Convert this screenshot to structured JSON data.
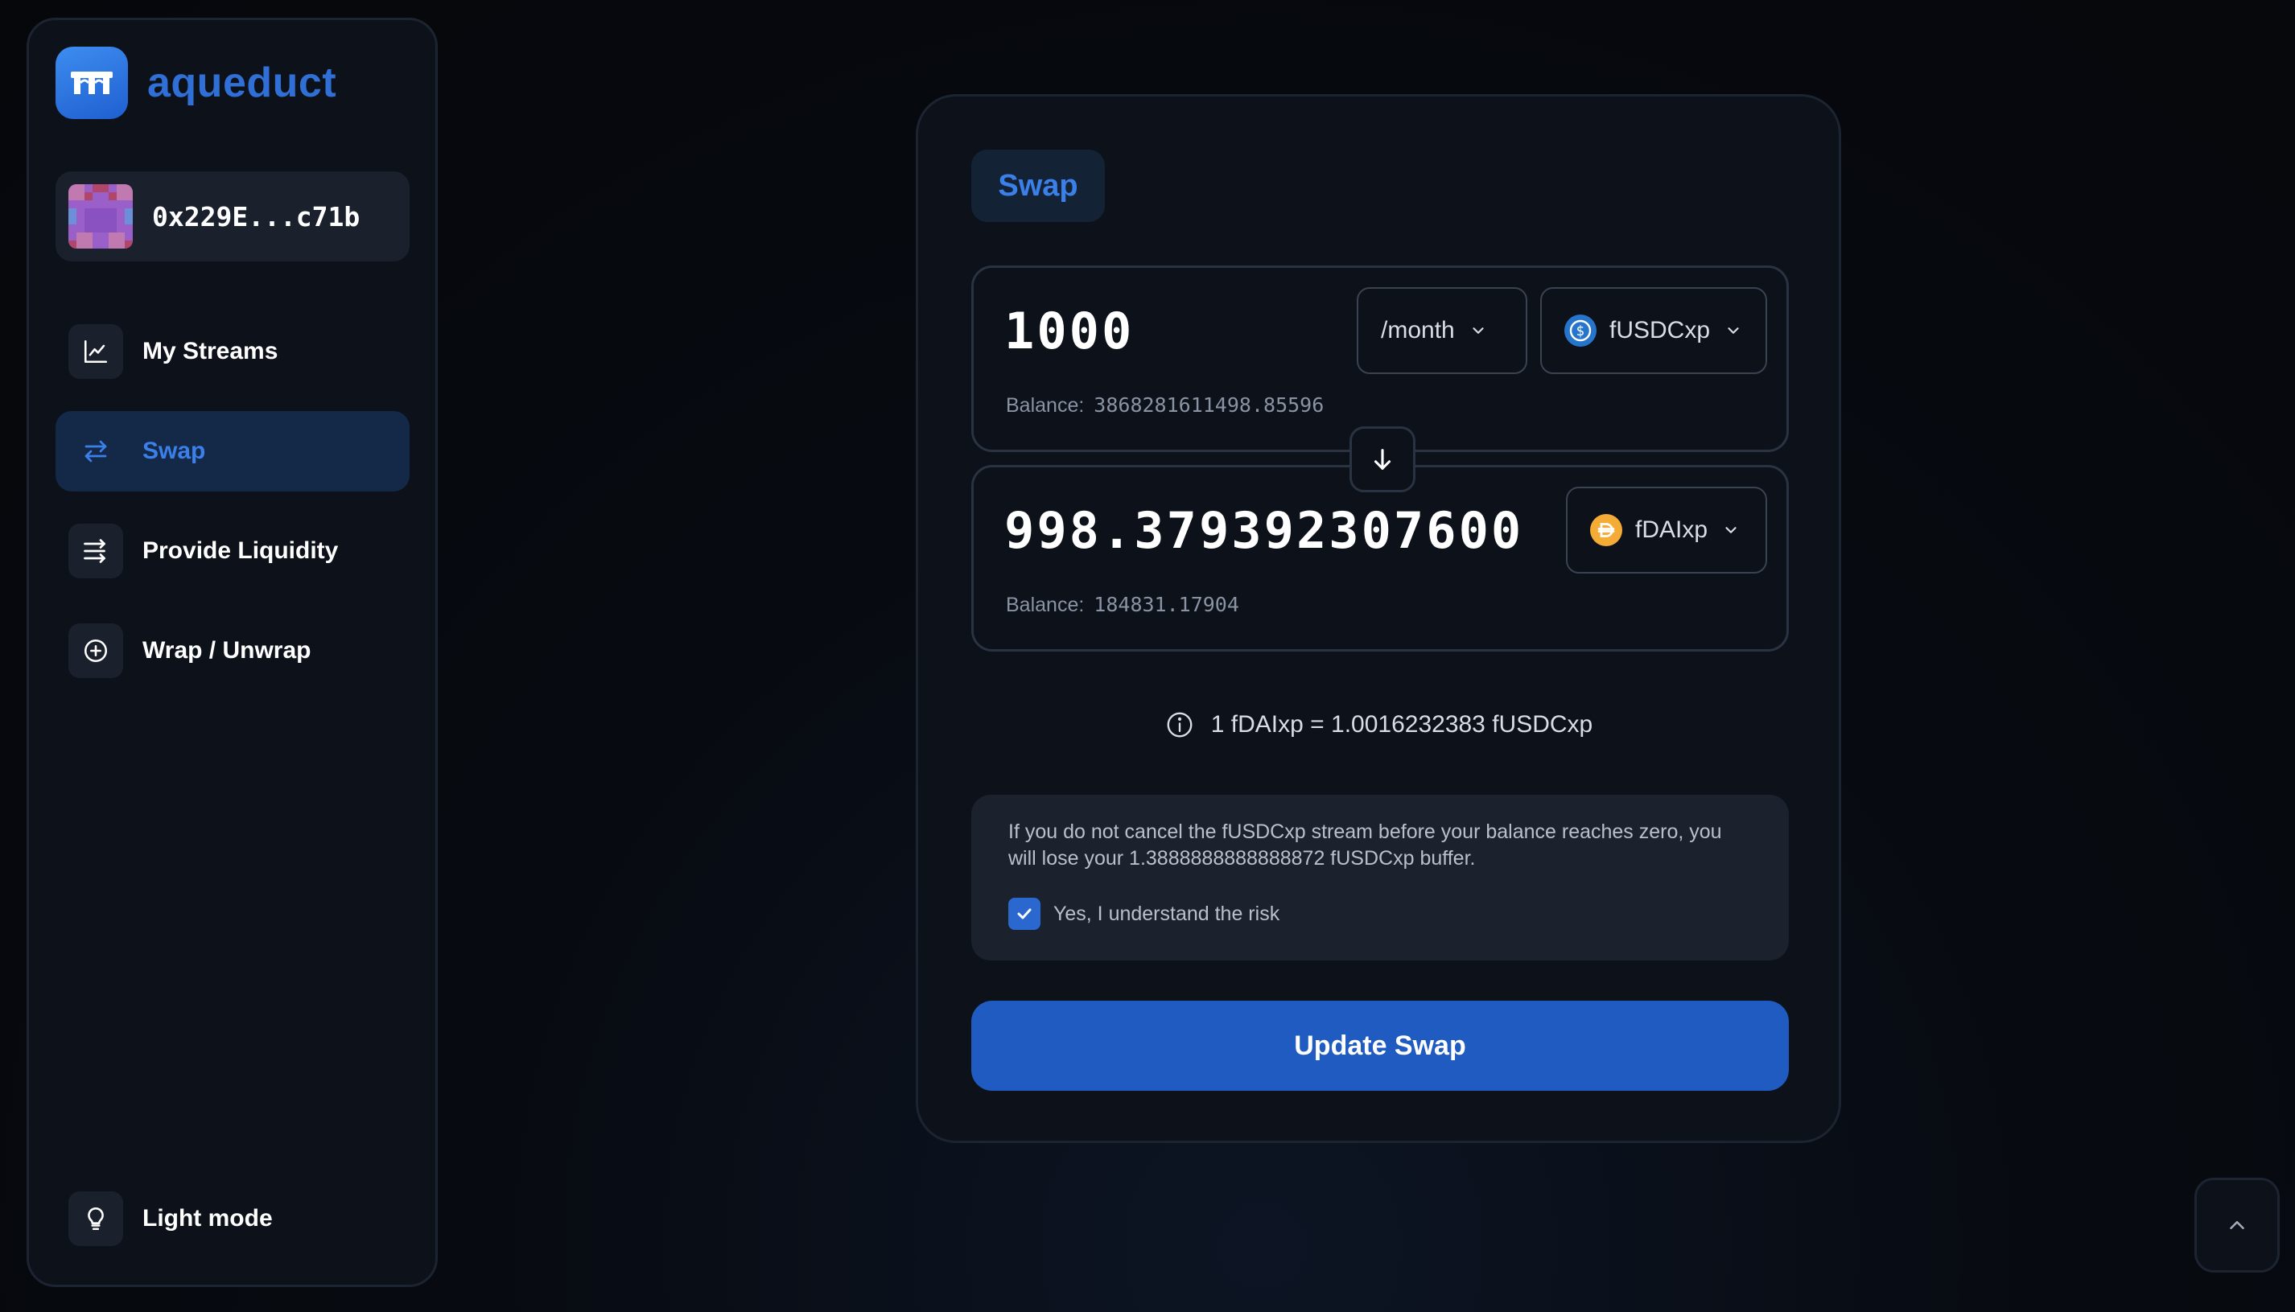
{
  "brand": {
    "name": "aqueduct",
    "logo_icon": "aqueduct-arch-logo"
  },
  "account": {
    "address": "0x229E...c71b",
    "avatar_icon": "pixel-avatar"
  },
  "sidebar": {
    "items": [
      {
        "label": "My Streams",
        "icon": "chart-line-icon",
        "active": false
      },
      {
        "label": "Swap",
        "icon": "swap-arrows-icon",
        "active": true
      },
      {
        "label": "Provide Liquidity",
        "icon": "liquidity-arrows-icon",
        "active": false
      },
      {
        "label": "Wrap / Unwrap",
        "icon": "plus-circle-icon",
        "active": false
      }
    ],
    "theme_toggle": {
      "label": "Light mode",
      "icon": "lightbulb-icon"
    }
  },
  "swap": {
    "tab_label": "Swap",
    "from": {
      "amount": "1000",
      "period": "/month",
      "token": "fUSDCxp",
      "balance_label": "Balance:",
      "balance_value": "3868281611498.85596"
    },
    "to": {
      "amount": "998.379392307600",
      "token": "fDAIxp",
      "balance_label": "Balance:",
      "balance_value": "184831.17904"
    },
    "rate": "1 fDAIxp = 1.0016232383 fUSDCxp",
    "warning": {
      "text": "If you do not cancel the fUSDCxp stream before your balance reaches zero, you will lose your 1.3888888888888872 fUSDCxp buffer.",
      "ack_label": "Yes, I understand the risk",
      "ack_checked": true
    },
    "submit_label": "Update Swap"
  },
  "colors": {
    "accent": "#2f6fd6",
    "button": "#1f5bc0",
    "usdc": "#2775ca",
    "dai": "#f5ac37"
  }
}
